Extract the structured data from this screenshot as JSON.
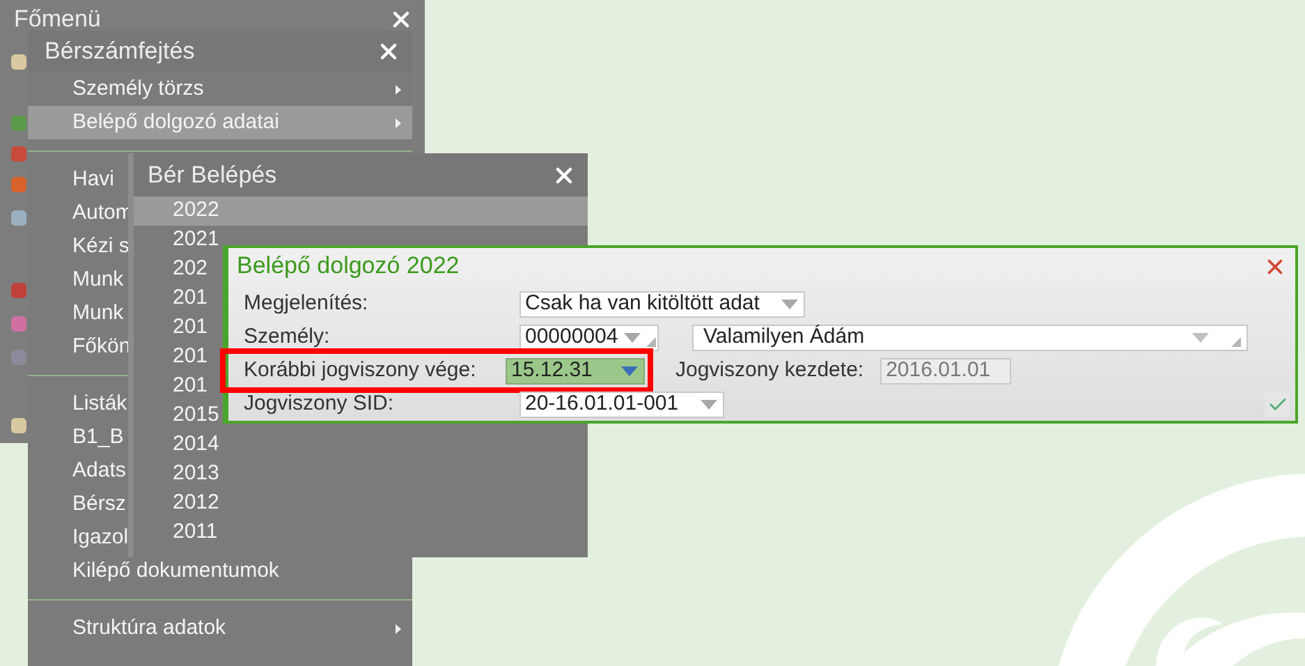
{
  "main_menu": {
    "title": "Főmenü"
  },
  "payroll_menu": {
    "title": "Bérszámfejtés",
    "sections": [
      [
        {
          "label": "Személy törzs",
          "submenu": true,
          "selected": false
        },
        {
          "label": "Belépő dolgozó adatai",
          "submenu": true,
          "selected": true
        }
      ],
      [
        {
          "label": "Havi",
          "submenu": false,
          "selected": false
        },
        {
          "label": "Autom",
          "submenu": false,
          "selected": false
        },
        {
          "label": "Kézi s",
          "submenu": false,
          "selected": false
        },
        {
          "label": "Munk",
          "submenu": false,
          "selected": false
        },
        {
          "label": "Munk",
          "submenu": false,
          "selected": false
        },
        {
          "label": "Főkön",
          "submenu": false,
          "selected": false
        }
      ],
      [
        {
          "label": "Listák",
          "submenu": false,
          "selected": false
        },
        {
          "label": "B1_B",
          "submenu": false,
          "selected": false
        },
        {
          "label": "Adats",
          "submenu": false,
          "selected": false
        },
        {
          "label": "Bérsz",
          "submenu": false,
          "selected": false
        },
        {
          "label": "Igazol",
          "submenu": false,
          "selected": false
        },
        {
          "label": "Kilépő dokumentumok",
          "submenu": false,
          "selected": false
        }
      ],
      [
        {
          "label": "Struktúra adatok",
          "submenu": true,
          "selected": false
        }
      ]
    ]
  },
  "entry_menu": {
    "title": "Bér Belépés",
    "years": [
      {
        "label": "2022",
        "selected": true
      },
      {
        "label": "2021",
        "selected": false
      },
      {
        "label": "202",
        "selected": false
      },
      {
        "label": "201",
        "selected": false
      },
      {
        "label": "201",
        "selected": false
      },
      {
        "label": "201",
        "selected": false
      },
      {
        "label": "201",
        "selected": false
      },
      {
        "label": "2015",
        "selected": false
      },
      {
        "label": "2014",
        "selected": false
      },
      {
        "label": "2013",
        "selected": false
      },
      {
        "label": "2012",
        "selected": false
      },
      {
        "label": "2011",
        "selected": false
      }
    ]
  },
  "dialog": {
    "title": "Belépő dolgozó 2022",
    "rows": [
      {
        "kind": "select",
        "label": "Megjelenítés:",
        "value": "Csak ha van kitöltött adat",
        "highlighted": false,
        "focused": false
      },
      {
        "kind": "person",
        "label": "Személy:",
        "code": "00000004",
        "name": "Valamilyen Ádám",
        "highlighted": false,
        "focused": false
      },
      {
        "kind": "date",
        "label": "Korábbi jogviszony vége:",
        "value": "15.12.31",
        "highlighted": true,
        "focused": true,
        "secondary_label": "Jogviszony kezdete:",
        "secondary_value": "2016.01.01"
      },
      {
        "kind": "select",
        "label": "Jogviszony SID:",
        "value": "20-16.01.01-001",
        "highlighted": false,
        "focused": false
      }
    ]
  }
}
